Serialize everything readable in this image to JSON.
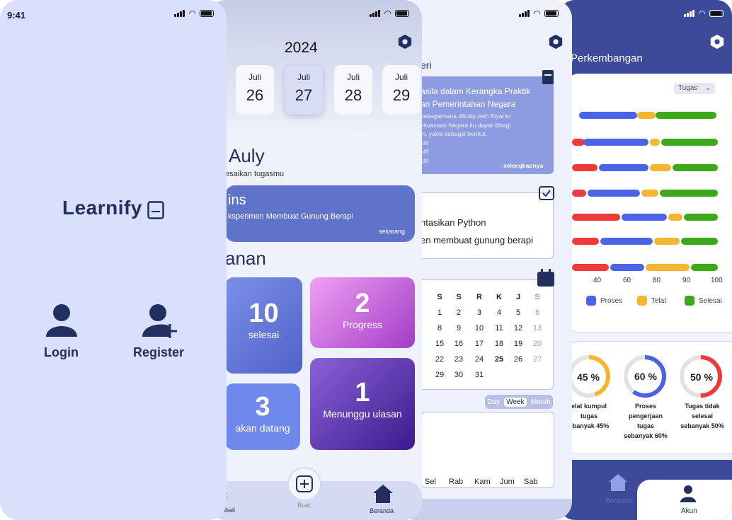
{
  "colors": {
    "blue": "#4b63e6",
    "yellow": "#f4b630",
    "green": "#3ca81a",
    "red": "#ee3a3a",
    "navy": "#23305f"
  },
  "s1": {
    "time": "9:41",
    "brand": "Learnify",
    "login": "Login",
    "register": "Register"
  },
  "s2": {
    "year": "2024",
    "dates": [
      {
        "m": "Juli",
        "d": "26"
      },
      {
        "m": "Juli",
        "d": "27"
      },
      {
        "m": "Juli",
        "d": "28"
      },
      {
        "m": "Juli",
        "d": "29"
      }
    ],
    "greeting": "Auly",
    "subgreeting": "esaikan tugasmu",
    "task_title": "ins",
    "task_desc": "ksperimen Membuat Gunung Berapi",
    "task_time": "sekarang",
    "section": "anan",
    "tiles": [
      {
        "num": "10",
        "label": "selesai"
      },
      {
        "num": "2",
        "label": "Progress"
      },
      {
        "num": "3",
        "label": "akan datang"
      },
      {
        "num": "1",
        "label": "Menunggu ulasan"
      }
    ],
    "nav": {
      "back": "nbali",
      "create": "Buat",
      "home": "Beranda"
    }
  },
  "s3": {
    "heading": "eri",
    "card_title": "asila dalam Kerangka Praktik\nan Pemerintahan Negara",
    "card_body": "sebagaimana dikutip oleh Riyanto\nekuasaan Negara itu dapat dibagi\nm, yakni sebagai berikut.\natif\nutif\natif",
    "card_more": "selengkapnya",
    "task1": "ntasikan Python",
    "task2": "en membuat gunung berapi",
    "cal_head": [
      "S",
      "S",
      "R",
      "K",
      "J",
      "S"
    ],
    "cal_rows": [
      [
        "1",
        "2",
        "3",
        "4",
        "5",
        "6"
      ],
      [
        "8",
        "9",
        "10",
        "11",
        "12",
        "13"
      ],
      [
        "15",
        "16",
        "17",
        "18",
        "19",
        "20"
      ],
      [
        "22",
        "23",
        "24",
        "25",
        "26",
        "27"
      ],
      [
        "29",
        "30",
        "31",
        "",
        "",
        ""
      ]
    ],
    "toggle": [
      "Day",
      "Week",
      "Month"
    ],
    "days": [
      "Sel",
      "Rab",
      "Kam",
      "Jum",
      "Sab"
    ]
  },
  "s4": {
    "title": "Perkembangan",
    "select": "Tugas",
    "xticks": [
      "40",
      "60",
      "80",
      "90",
      "100"
    ],
    "legend": [
      "Proses",
      "Telat",
      "Selesai"
    ],
    "donuts": [
      {
        "value": "45 %",
        "caption": "elat kumpul\ntugas\nebanyak 45%"
      },
      {
        "value": "60 %",
        "caption": "Proses\npengerjaan\ntugas\nsebanyak 60%"
      },
      {
        "value": "50 %",
        "caption": "Tugas tidak\nselesai\nsebanyak 50%"
      }
    ],
    "nav": {
      "home": "Beranda",
      "account": "Akun"
    }
  }
}
